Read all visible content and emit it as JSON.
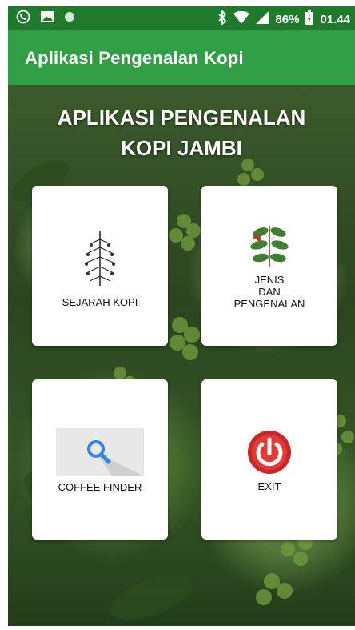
{
  "status_bar": {
    "left_icons": [
      "whatsapp-icon",
      "image-icon",
      "circle-icon"
    ],
    "right_icons": [
      "bluetooth-icon",
      "wifi-icon",
      "signal-icon",
      "battery-charging-icon"
    ],
    "battery_percent": "86%",
    "time": "01.44"
  },
  "app_bar": {
    "title": "Aplikasi Pengenalan Kopi",
    "color": "#2f9e44"
  },
  "main": {
    "title_line1": "APLIKASI PENGENALAN",
    "title_line2": "KOPI JAMBI",
    "cards": [
      {
        "label": "SEJARAH KOPI",
        "icon": "coffee-plant-sketch-icon"
      },
      {
        "label_line1": "JENIS",
        "label_line2": "DAN",
        "label_line3": "PENGENALAN",
        "icon": "coffee-branch-icon"
      },
      {
        "label": "COFFEE FINDER",
        "icon": "search-icon"
      },
      {
        "label": "EXIT",
        "icon": "power-icon"
      }
    ]
  }
}
